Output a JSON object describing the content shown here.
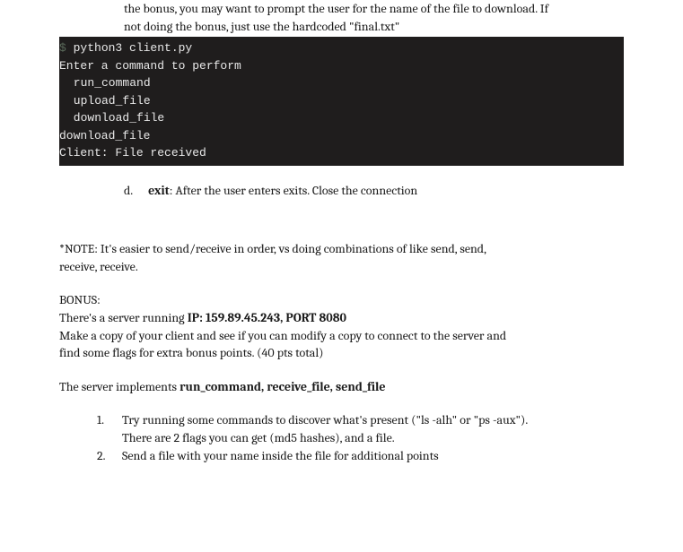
{
  "intro": {
    "line1": "the bonus, you may want to prompt the user for the name of the file to download. If",
    "line2": "not doing the bonus, just use the hardcoded \"final.txt\""
  },
  "terminal": {
    "dollar": "$",
    "cmd": " python3 client.py",
    "l2": "Enter a command to perform",
    "l3": " run_command",
    "l4": " upload_file",
    "l5": " download_file",
    "l6": "download_file",
    "l7": "Client: File received"
  },
  "itemD": {
    "marker": "d.",
    "bold": "exit",
    "rest": ": After the user enters exits. Close the connection"
  },
  "note": {
    "l1": "*NOTE: It's easier to send/receive in order, vs doing combinations of like send, send,",
    "l2": "receive, receive."
  },
  "bonus": {
    "heading": "BONUS:",
    "line1a": "There's a server running ",
    "line1b": "IP: 159.89.45.243, PORT 8080",
    "line2": "Make a copy of your client and see if you can modify a copy to connect to the server and",
    "line3": "find some flags for extra bonus points. (40 pts total)"
  },
  "impl": {
    "pre": "The server implements ",
    "bold": "run_command, receive_file, send_file"
  },
  "list": {
    "n1": "1.",
    "i1a": "Try running some commands to discover what's present (\"ls -alh\" or \"ps -aux\").",
    "i1b": "There are 2 flags you can get (md5 hashes), and a file.",
    "n2": "2.",
    "i2": "Send a file with your name inside the file for additional points"
  }
}
